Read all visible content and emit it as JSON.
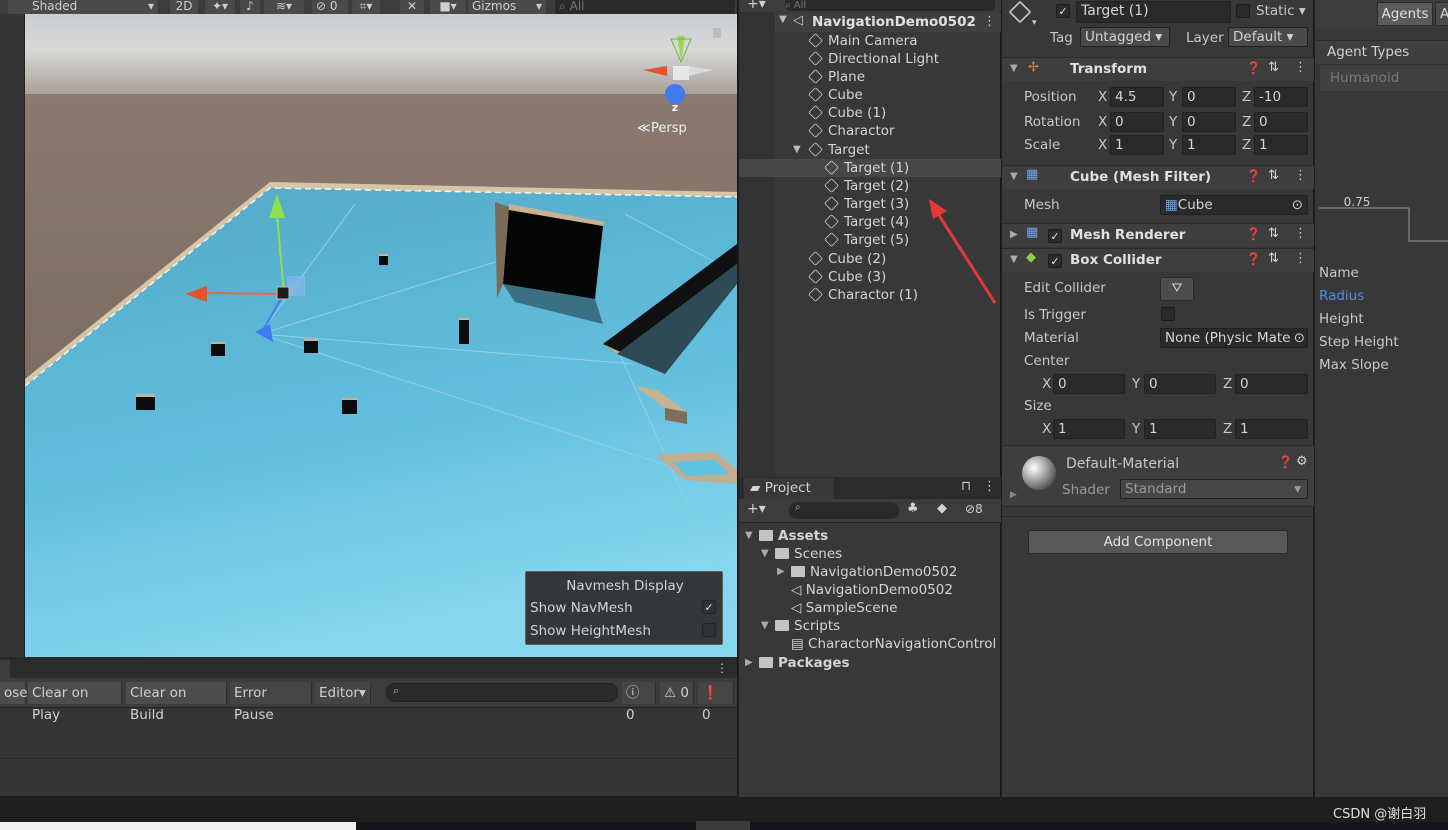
{
  "scene": {
    "toolbar": {
      "shading_mode": "Shaded",
      "mode_2d": "2D",
      "hidden_count": "0",
      "gizmos": "Gizmos",
      "search_placeholder": "All"
    },
    "gizmo": {
      "axis_label": "z",
      "projection": "Persp"
    },
    "navmesh_overlay": {
      "title": "Navmesh Display",
      "show_navmesh": {
        "label": "Show NavMesh",
        "checked": "✓"
      },
      "show_heightmesh": {
        "label": "Show HeightMesh",
        "checked": ""
      }
    }
  },
  "console": {
    "buttons": [
      "ose",
      "Clear on Play",
      "Clear on Build",
      "Error Pause",
      "Editor"
    ],
    "counts": {
      "messages": "0",
      "warnings": "0",
      "errors": "0"
    }
  },
  "hierarchy": {
    "search_placeholder": "All",
    "scene_name": "NavigationDemo0502",
    "items": [
      {
        "label": "Main Camera",
        "indent": 1
      },
      {
        "label": "Directional Light",
        "indent": 1
      },
      {
        "label": "Plane",
        "indent": 1
      },
      {
        "label": "Cube",
        "indent": 1
      },
      {
        "label": "Cube (1)",
        "indent": 1
      },
      {
        "label": "Charactor",
        "indent": 1
      },
      {
        "label": "Target",
        "indent": 1
      },
      {
        "label": "Target (1)",
        "indent": 2
      },
      {
        "label": "Target (2)",
        "indent": 2
      },
      {
        "label": "Target (3)",
        "indent": 2
      },
      {
        "label": "Target (4)",
        "indent": 2
      },
      {
        "label": "Target (5)",
        "indent": 2
      },
      {
        "label": "Cube (2)",
        "indent": 1
      },
      {
        "label": "Cube (3)",
        "indent": 1
      },
      {
        "label": "Charactor (1)",
        "indent": 1
      }
    ]
  },
  "project": {
    "tab": "Project",
    "hidden_count": "8",
    "tree": [
      {
        "label": "Assets",
        "bold": true
      },
      {
        "label": "Scenes"
      },
      {
        "label": "NavigationDemo0502"
      },
      {
        "label": "NavigationDemo0502"
      },
      {
        "label": "SampleScene"
      },
      {
        "label": "Scripts"
      },
      {
        "label": "CharactorNavigationControl"
      },
      {
        "label": "Packages",
        "bold": true
      }
    ]
  },
  "inspector": {
    "object_name": "Target (1)",
    "static_label": "Static",
    "tag_label": "Tag",
    "tag_value": "Untagged",
    "layer_label": "Layer",
    "layer_value": "Default",
    "transform": {
      "title": "Transform",
      "position_label": "Position",
      "pos": [
        "4.5",
        "0",
        "-10"
      ],
      "rotation_label": "Rotation",
      "rot": [
        "0",
        "0",
        "0"
      ],
      "scale_label": "Scale",
      "scale": [
        "1",
        "1",
        "1"
      ]
    },
    "axes": [
      "X",
      "Y",
      "Z"
    ],
    "mesh_filter": {
      "title": "Cube (Mesh Filter)",
      "mesh_label": "Mesh",
      "mesh_value": "Cube"
    },
    "mesh_renderer": {
      "title": "Mesh Renderer"
    },
    "box_collider": {
      "title": "Box Collider",
      "edit_label": "Edit Collider",
      "trigger_label": "Is Trigger",
      "material_label": "Material",
      "material_value": "None (Physic Mate",
      "center_label": "Center",
      "center": [
        "0",
        "0",
        "0"
      ],
      "size_label": "Size",
      "size": [
        "1",
        "1",
        "1"
      ]
    },
    "material": {
      "name": "Default-Material",
      "shader_label": "Shader",
      "shader_value": "Standard"
    },
    "add_component": "Add Component"
  },
  "navigation": {
    "tabs": [
      "Agents",
      "A"
    ],
    "agent_types_label": "Agent Types",
    "agent_type": "Humanoid",
    "radius_value": "0.75",
    "props": [
      "Name",
      "Radius",
      "Height",
      "Step Height",
      "Max Slope"
    ]
  },
  "watermark": "CSDN @谢白羽",
  "colors": {
    "accent": "#4c7fe6",
    "arrow": "#e53935",
    "plane": "#56b9d8"
  }
}
